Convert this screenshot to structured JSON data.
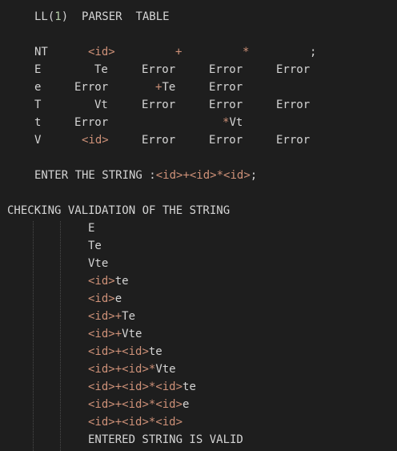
{
  "title": {
    "pre": "LL(",
    "num": "1",
    "post": ")  PARSER  TABLE"
  },
  "table": {
    "headers": {
      "nt": "NT",
      "c1": "<id>",
      "c2": "+",
      "c3": "*",
      "c4": ";"
    },
    "rows": [
      {
        "nt": "E",
        "c1": "Te",
        "c2": "Error",
        "c3": "Error",
        "c4": "Error"
      },
      {
        "nt": "e",
        "c1": "Error",
        "c2_op": "+",
        "c2": "Te",
        "c3": "Error",
        "c4": ""
      },
      {
        "nt": "T",
        "c1": "Vt",
        "c2": "Error",
        "c3": "Error",
        "c4": "Error"
      },
      {
        "nt": "t",
        "c1": "Error",
        "c2": "",
        "c3_op": "*",
        "c3": "Vt",
        "c4": ""
      },
      {
        "nt": "V",
        "c1": "<id>",
        "c2": "Error",
        "c3": "Error",
        "c4": "Error"
      }
    ]
  },
  "input": {
    "label": "ENTER THE STRING :",
    "id1": "<id>",
    "op1": "+",
    "id2": "<id>",
    "op2": "*",
    "id3": "<id>",
    "end": ";"
  },
  "validation": {
    "heading": "CHECKING VALIDATION OF THE STRING",
    "steps": [
      [
        "E"
      ],
      [
        "Te"
      ],
      [
        "Vte"
      ],
      [
        "<id>",
        "te"
      ],
      [
        "<id>",
        "e"
      ],
      [
        "<id>",
        "+",
        "Te"
      ],
      [
        "<id>",
        "+",
        "Vte"
      ],
      [
        "<id>",
        "+",
        "<id>",
        "te"
      ],
      [
        "<id>",
        "+",
        "<id>",
        "*",
        "Vte"
      ],
      [
        "<id>",
        "+",
        "<id>",
        "*",
        "<id>",
        "te"
      ],
      [
        "<id>",
        "+",
        "<id>",
        "*",
        "<id>",
        "e"
      ],
      [
        "<id>",
        "+",
        "<id>",
        "*",
        "<id>"
      ]
    ],
    "result": "ENTERED STRING IS VALID"
  }
}
